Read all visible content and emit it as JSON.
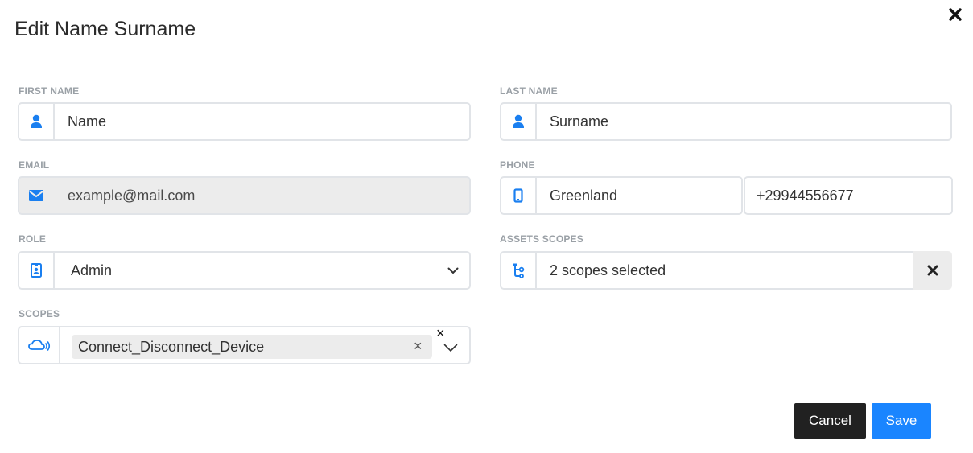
{
  "modal": {
    "title": "Edit Name Surname",
    "close_icon": "close-icon"
  },
  "form": {
    "first_name": {
      "label": "FIRST NAME",
      "value": "Name",
      "icon": "user-icon"
    },
    "last_name": {
      "label": "LAST NAME",
      "value": "Surname",
      "icon": "user-icon"
    },
    "email": {
      "label": "EMAIL",
      "value": "example@mail.com",
      "icon": "envelope-icon",
      "disabled": true
    },
    "phone": {
      "label": "PHONE",
      "country": "Greenland",
      "number": "+29944556677",
      "icon": "mobile-icon"
    },
    "role": {
      "label": "ROLE",
      "selected": "Admin",
      "icon": "id-badge-icon"
    },
    "assets_scopes": {
      "label": "ASSETS SCOPES",
      "value": "2 scopes selected",
      "icon": "sitemap-icon"
    },
    "scopes": {
      "label": "SCOPES",
      "chips": [
        "Connect_Disconnect_Device"
      ],
      "icon": "cloud-signal-icon"
    }
  },
  "actions": {
    "cancel_label": "Cancel",
    "save_label": "Save"
  },
  "colors": {
    "accent": "#1a85ff",
    "icon_blue": "#1a7ff0",
    "cancel_bg": "#212121",
    "border": "#e1e4e8",
    "disabled_bg": "#ececec",
    "label_gray": "#9aa0a6"
  }
}
